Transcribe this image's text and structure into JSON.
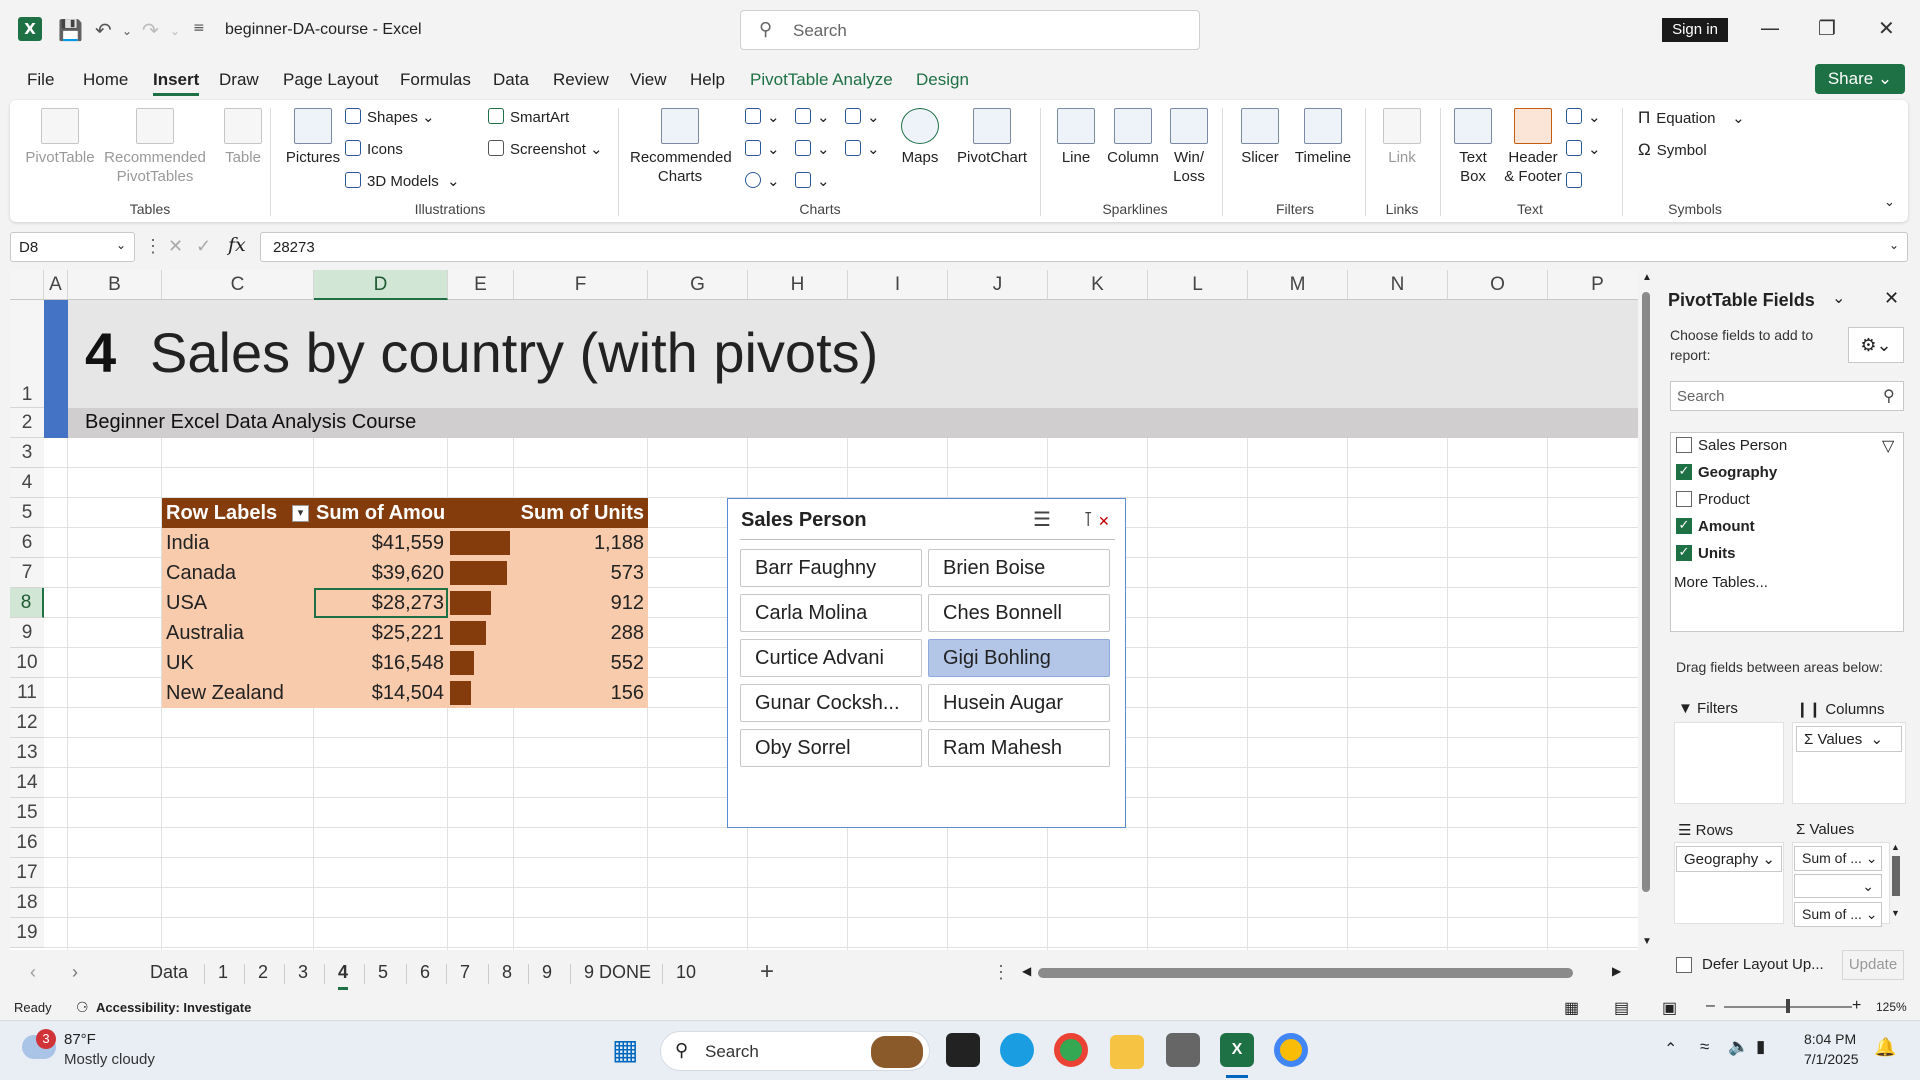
{
  "titlebar": {
    "app_logo": "X",
    "doc_title": "beginner-DA-course  -  Excel",
    "search_placeholder": "Search",
    "sign_in": "Sign in",
    "icons": [
      "save-icon",
      "undo-icon",
      "redo-icon",
      "customize-icon",
      "minimize-icon",
      "restore-icon",
      "close-icon"
    ]
  },
  "menu": {
    "tabs": [
      "File",
      "Home",
      "Insert",
      "Draw",
      "Page Layout",
      "Formulas",
      "Data",
      "Review",
      "View",
      "Help",
      "PivotTable Analyze",
      "Design"
    ],
    "active": "Insert",
    "share": "Share"
  },
  "ribbon": {
    "groups": {
      "tables": "Tables",
      "illustrations": "Illustrations",
      "charts": "Charts",
      "sparklines": "Sparklines",
      "filters": "Filters",
      "links": "Links",
      "text": "Text",
      "symbols": "Symbols"
    },
    "pivottable": "PivotTable",
    "recommended_pivottables_1": "Recommended",
    "recommended_pivottables_2": "PivotTables",
    "table": "Table",
    "pictures": "Pictures",
    "shapes": "Shapes",
    "icons": "Icons",
    "models": "3D Models",
    "smartart": "SmartArt",
    "screenshot": "Screenshot",
    "recommended_charts_1": "Recommended",
    "recommended_charts_2": "Charts",
    "maps": "Maps",
    "pivotchart": "PivotChart",
    "line": "Line",
    "column": "Column",
    "winloss_1": "Win/",
    "winloss_2": "Loss",
    "slicer": "Slicer",
    "timeline": "Timeline",
    "link": "Link",
    "textbox_1": "Text",
    "textbox_2": "Box",
    "header_1": "Header",
    "header_2": "& Footer",
    "equation": "Equation",
    "symbol": "Symbol"
  },
  "formula": {
    "namebox": "D8",
    "fx": "fx",
    "value": "28273"
  },
  "columns": [
    "A",
    "B",
    "C",
    "D",
    "E",
    "F",
    "G",
    "H",
    "I",
    "J",
    "K",
    "L",
    "M",
    "N",
    "O",
    "P"
  ],
  "selected_column": "D",
  "rows": [
    "1",
    "2",
    "3",
    "4",
    "5",
    "6",
    "7",
    "8",
    "9",
    "10",
    "11",
    "12",
    "13",
    "14",
    "15",
    "16",
    "17",
    "18",
    "19"
  ],
  "selected_row": "8",
  "sheet": {
    "title_num": "4",
    "title": "Sales by country (with pivots)",
    "subtitle": "Beginner Excel Data Analysis Course"
  },
  "pivot": {
    "headers": [
      "Row Labels",
      "Sum of Amou",
      "Sum of Units"
    ],
    "rows": [
      {
        "label": "India",
        "amount": "$41,559",
        "units": "1,188",
        "share": 1.0
      },
      {
        "label": "Canada",
        "amount": "$39,620",
        "units": "573",
        "share": 0.953
      },
      {
        "label": "USA",
        "amount": "$28,273",
        "units": "912",
        "share": 0.68
      },
      {
        "label": "Australia",
        "amount": "$25,221",
        "units": "288",
        "share": 0.607
      },
      {
        "label": "UK",
        "amount": "$16,548",
        "units": "552",
        "share": 0.398
      },
      {
        "label": "New Zealand",
        "amount": "$14,504",
        "units": "156",
        "share": 0.349
      }
    ]
  },
  "slicer": {
    "title": "Sales Person",
    "items": [
      "Barr Faughny",
      "Brien Boise",
      "Carla Molina",
      "Ches Bonnell",
      "Curtice Advani",
      "Gigi Bohling",
      "Gunar Cocksh...",
      "Husein Augar",
      "Oby Sorrel",
      "Ram Mahesh"
    ],
    "selected": "Gigi Bohling"
  },
  "sheet_tabs": [
    "Data",
    "1",
    "2",
    "3",
    "4",
    "5",
    "6",
    "7",
    "8",
    "9",
    "9 DONE",
    "10"
  ],
  "active_tab": "4",
  "pivot_fields": {
    "title": "PivotTable Fields",
    "choose": "Choose fields to add to",
    "choose2": "report:",
    "search_placeholder": "Search",
    "fields": [
      {
        "name": "Sales Person",
        "checked": false
      },
      {
        "name": "Geography",
        "checked": true
      },
      {
        "name": "Product",
        "checked": false
      },
      {
        "name": "Amount",
        "checked": true
      },
      {
        "name": "Units",
        "checked": true
      }
    ],
    "more_tables": "More Tables...",
    "drag_label": "Drag fields between areas below:",
    "filters": "Filters",
    "columns": "Columns",
    "rows": "Rows",
    "values": "Values",
    "columns_item": "Values",
    "rows_item": "Geography",
    "values_item1": "Sum of ...",
    "values_item2": "",
    "values_item3": "Sum of ...",
    "defer": "Defer Layout Up...",
    "update": "Update"
  },
  "status": {
    "ready": "Ready",
    "accessibility": "Accessibility: Investigate",
    "zoom": "125%"
  },
  "taskbar": {
    "badge": "3",
    "temp": "87°F",
    "weather": "Mostly cloudy",
    "search": "Search",
    "time": "8:04 PM",
    "date": "7/1/2025"
  },
  "colors": {
    "excel_green": "#1e7145",
    "pivot_header": "#843c0c",
    "pivot_body": "#f8cbad",
    "slicer_selected": "#b4c6e7"
  }
}
